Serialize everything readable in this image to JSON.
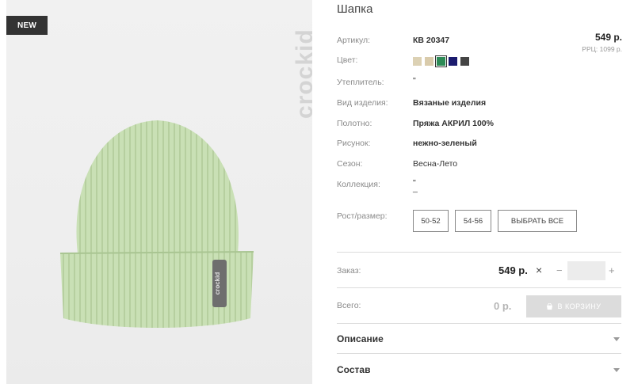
{
  "badge": "NEW",
  "brand": "crockid",
  "product": {
    "title": "Шапка",
    "price": "549 р.",
    "rrp": "РРЦ: 1099 р."
  },
  "attributes": [
    {
      "label": "Артикул:",
      "value": "КВ 20347"
    },
    {
      "label": "Цвет:",
      "value": ""
    },
    {
      "label": "Утеплитель:",
      "value": "\""
    },
    {
      "label": "Вид изделия:",
      "value": "Вязаные изделия"
    },
    {
      "label": "Полотно:",
      "value": "Пряжа АКРИЛ 100%"
    },
    {
      "label": "Рисунок:",
      "value": "нежно-зеленый"
    },
    {
      "label": "Сезон:",
      "value": "Весна-Лето"
    },
    {
      "label": "Коллекция:",
      "value": "\""
    },
    {
      "label": "Рост/размер:",
      "value": ""
    }
  ],
  "collection_extra": "_",
  "colors": [
    {
      "name": "beige-light",
      "hex": "#dcd1b4",
      "selected": false
    },
    {
      "name": "beige",
      "hex": "#d9cbab",
      "selected": false
    },
    {
      "name": "green",
      "hex": "#2e8b57",
      "selected": true
    },
    {
      "name": "navy",
      "hex": "#1b1b6e",
      "selected": false
    },
    {
      "name": "dark-gray",
      "hex": "#444444",
      "selected": false
    }
  ],
  "sizes": [
    "50-52",
    "54-56"
  ],
  "select_all": "ВЫБРАТЬ ВСЕ",
  "order": {
    "label": "Заказ:",
    "price": "549 р.",
    "times": "×",
    "minus": "−",
    "plus": "+",
    "quantity": ""
  },
  "total": {
    "label": "Всего:",
    "value": "0 р.",
    "cart_button": "В КОРЗИНУ"
  },
  "sections": {
    "description": "Описание",
    "composition": "Состав"
  }
}
